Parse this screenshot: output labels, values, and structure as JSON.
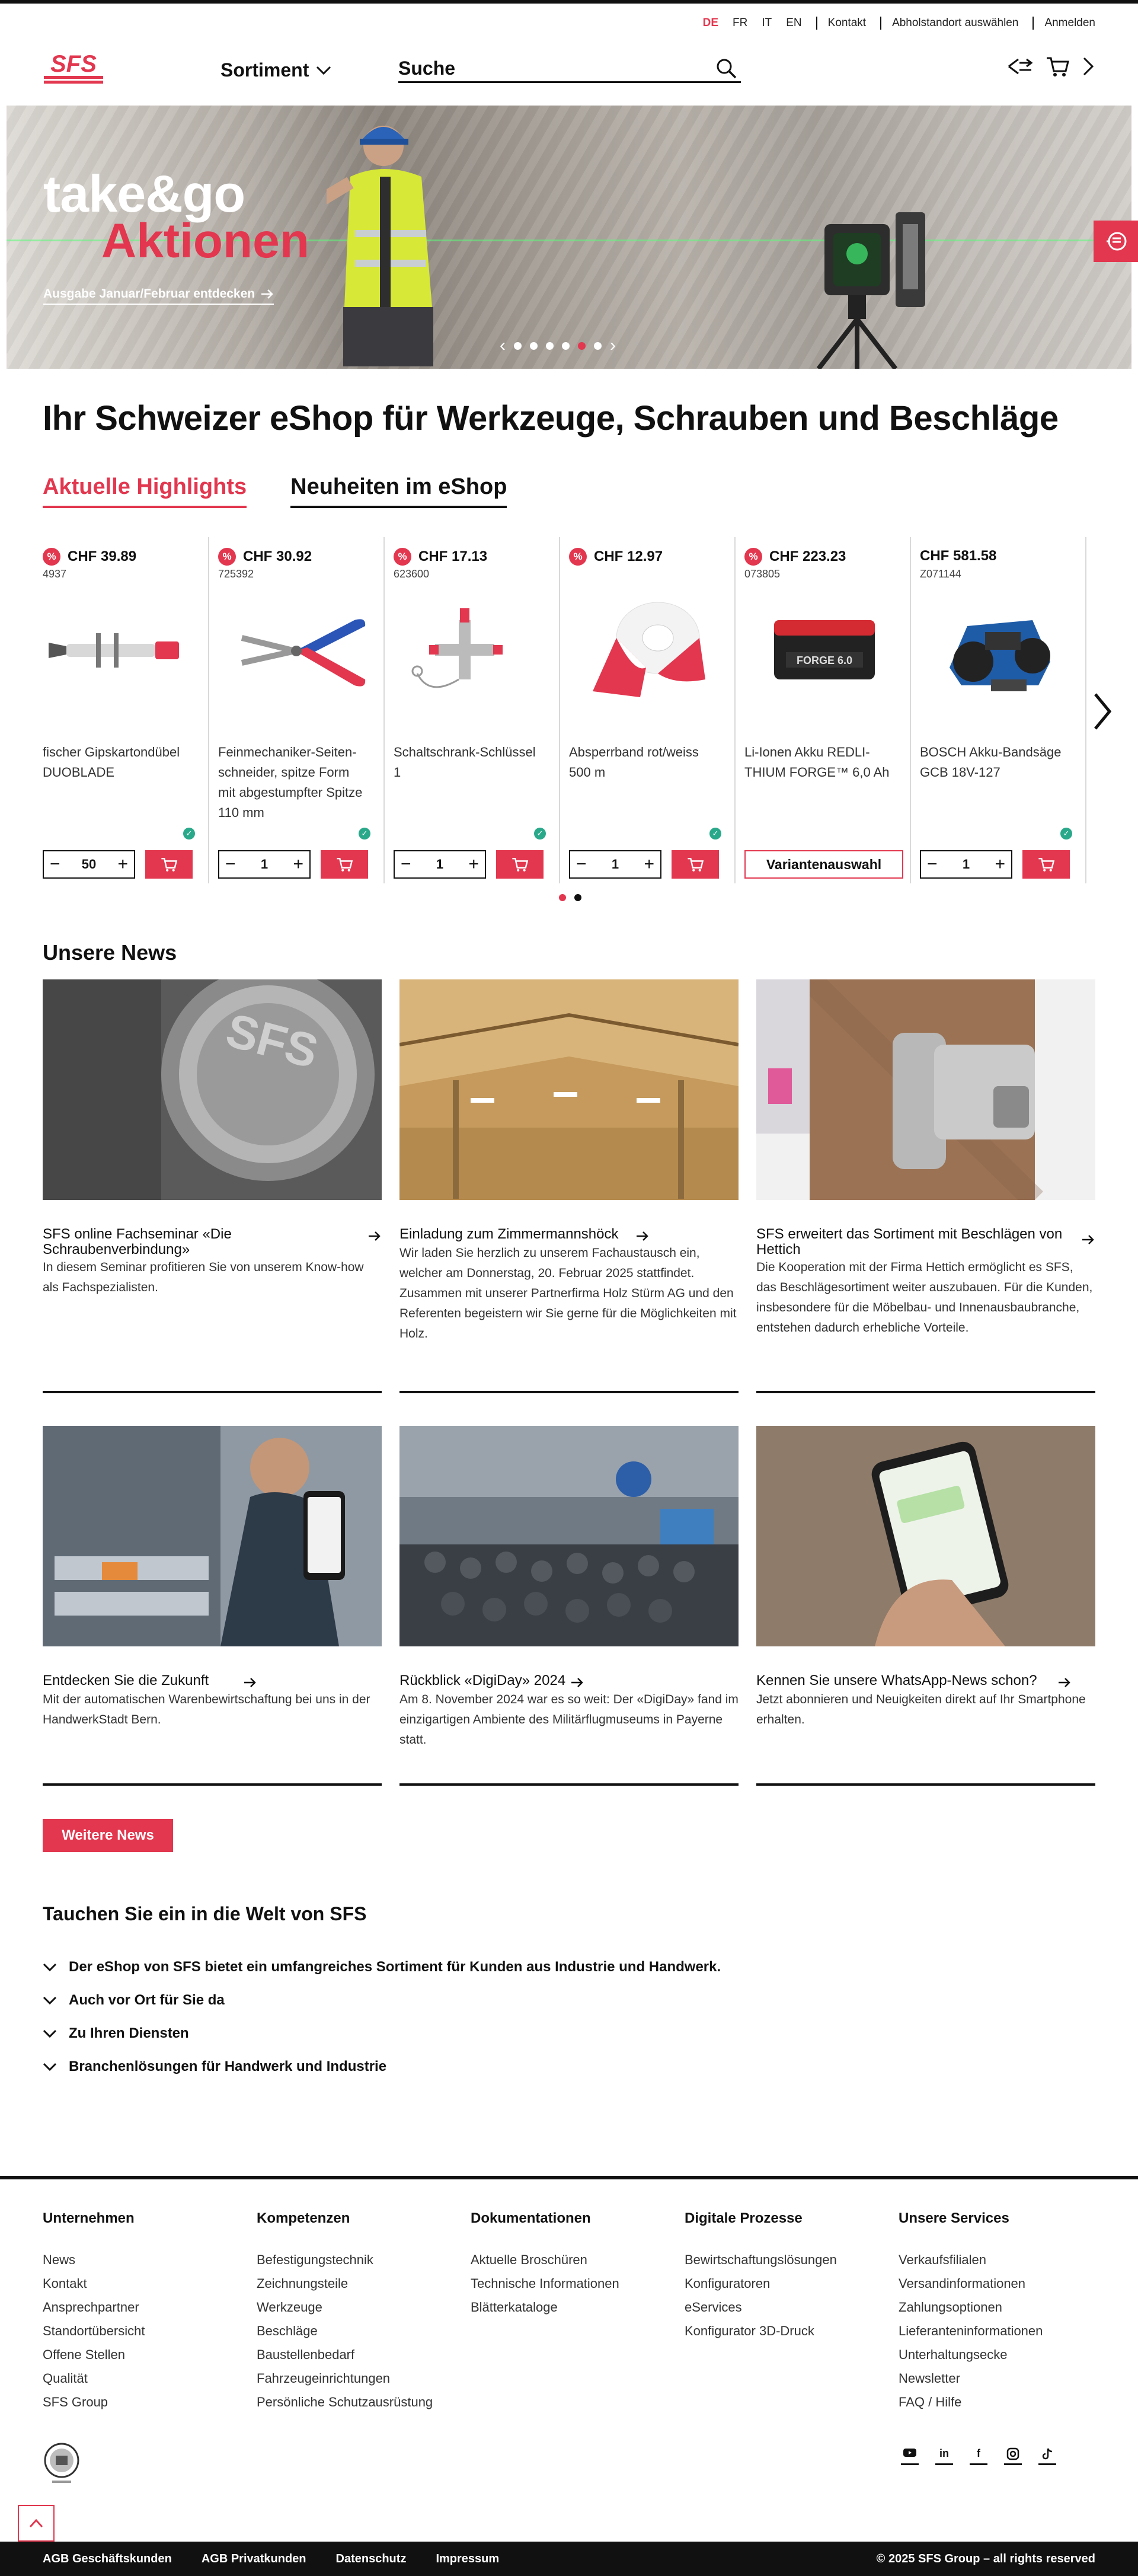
{
  "utility": {
    "languages": [
      "DE",
      "FR",
      "IT",
      "EN"
    ],
    "active_language": "DE",
    "links": [
      "Kontakt",
      "Abholstandort auswählen",
      "Anmelden"
    ]
  },
  "header": {
    "logo": "SFS",
    "nav_sortiment": "Sortiment",
    "search_placeholder": "Suche",
    "icons": [
      "compare-icon",
      "cart-icon",
      "chevron-right-icon"
    ]
  },
  "hero": {
    "title_line1": "take&go",
    "title_line2": "Aktionen",
    "link": "Ausgabe Januar/Februar entdecken",
    "slides": 6,
    "active_slide": 5
  },
  "page_title": "Ihr Schweizer eShop für Werkzeuge, Schrauben und Beschläge",
  "tabs": [
    "Aktuelle Highlights",
    "Neuheiten im eShop"
  ],
  "products": [
    {
      "price": "CHF 39.89",
      "sku": "4937",
      "name": "fischer Gipskartondübel DUOBLADE",
      "qty": "50",
      "sale": true,
      "action": "cart"
    },
    {
      "price": "CHF 30.92",
      "sku": "725392",
      "name": "Feinmechaniker-Seiten-schneider, spitze Form mit abgestumpfter Spitze 110 mm",
      "qty": "1",
      "sale": true,
      "action": "cart"
    },
    {
      "price": "CHF 17.13",
      "sku": "623600",
      "name": "Schaltschrank-Schlüssel 1",
      "qty": "1",
      "sale": true,
      "action": "cart"
    },
    {
      "price": "CHF 12.97",
      "sku": "",
      "name": "Absperrband rot/weiss 500 m",
      "qty": "1",
      "sale": true,
      "action": "cart"
    },
    {
      "price": "CHF 223.23",
      "sku": "073805",
      "name": "Li-Ionen Akku REDLI-THIUM FORGE™ 6,0 Ah",
      "qty": "",
      "sale": true,
      "action": "variant",
      "variant_label": "Variantenauswahl"
    },
    {
      "price": "CHF 581.58",
      "sku": "Z071144",
      "name": "BOSCH Akku-Bandsäge GCB 18V-127",
      "qty": "1",
      "sale": false,
      "action": "cart"
    }
  ],
  "sale_badge": "%",
  "news": {
    "heading": "Unsere News",
    "items": [
      {
        "title": "SFS online Fachseminar «Die Schraubenverbindung»",
        "desc": "In diesem Seminar profitieren Sie von unserem Know-how als Fachspezialisten."
      },
      {
        "title": "Einladung zum Zimmermannshöck",
        "desc": "Wir laden Sie herzlich zu unserem Fachaustausch ein, welcher am Donnerstag, 20. Februar 2025 stattfindet. Zusammen mit unserer Partnerfirma Holz Stürm AG und den Referenten begeistern wir Sie gerne für die Möglichkeiten mit Holz."
      },
      {
        "title": "SFS erweitert das Sortiment mit Beschlägen von Hettich",
        "desc": "Die Kooperation mit der Firma Hettich ermöglicht es SFS, das Beschlägesortiment weiter auszubauen. Für die Kunden, insbesondere für die Möbelbau- und Innenausbaubranche, entstehen dadurch erhebliche Vorteile."
      },
      {
        "title": "Entdecken Sie die Zukunft",
        "desc": "Mit der automatischen Warenbewirtschaftung bei uns in der HandwerkStadt Bern."
      },
      {
        "title": "Rückblick «DigiDay» 2024",
        "desc": "Am 8. November 2024 war es so weit: Der «DigiDay» fand im einzigartigen Ambiente des Militärflugmuseums in Payerne statt."
      },
      {
        "title": "Kennen Sie unsere WhatsApp-News schon?",
        "desc": "Jetzt abonnieren und Neuigkeiten direkt auf Ihr Smartphone erhalten."
      }
    ],
    "more_button": "Weitere News"
  },
  "accordion": {
    "heading": "Tauchen Sie ein in die Welt von SFS",
    "items": [
      "Der eShop von SFS bietet ein umfangreiches Sortiment für Kunden aus Industrie und Handwerk.",
      "Auch vor Ort für Sie da",
      "Zu Ihren Diensten",
      "Branchenlösungen für Handwerk und Industrie"
    ]
  },
  "footer": {
    "columns": [
      {
        "title": "Unternehmen",
        "links": [
          "News",
          "Kontakt",
          "Ansprechpartner",
          "Standortübersicht",
          "Offene Stellen",
          "Qualität",
          "SFS Group"
        ]
      },
      {
        "title": "Kompetenzen",
        "links": [
          "Befestigungstechnik",
          "Zeichnungsteile",
          "Werkzeuge",
          "Beschläge",
          "Baustellenbedarf",
          "Fahrzeugeinrichtungen",
          "Persönliche Schutzausrüstung"
        ]
      },
      {
        "title": "Dokumentationen",
        "links": [
          "Aktuelle Broschüren",
          "Technische Informationen",
          "Blätterkataloge"
        ]
      },
      {
        "title": "Digitale Prozesse",
        "links": [
          "Bewirtschaftungslösungen",
          "Konfiguratoren",
          "eServices",
          "Konfigurator 3D-Druck"
        ]
      },
      {
        "title": "Unsere Services",
        "links": [
          "Verkaufsfilialen",
          "Versandinformationen",
          "Zahlungsoptionen",
          "Lieferanteninformationen",
          "Unterhaltungsecke",
          "Newsletter",
          "FAQ / Hilfe"
        ]
      }
    ],
    "social": [
      "youtube-icon",
      "linkedin-icon",
      "facebook-icon",
      "instagram-icon",
      "tiktok-icon"
    ],
    "bottom_links": [
      "AGB Geschäftskunden",
      "AGB Privatkunden",
      "Datenschutz",
      "Impressum"
    ],
    "copyright": "© 2025 SFS Group – all rights reserved"
  },
  "colors": {
    "brand_red": "#e2374f",
    "ink": "#111111",
    "stock_green": "#2aa88a"
  }
}
